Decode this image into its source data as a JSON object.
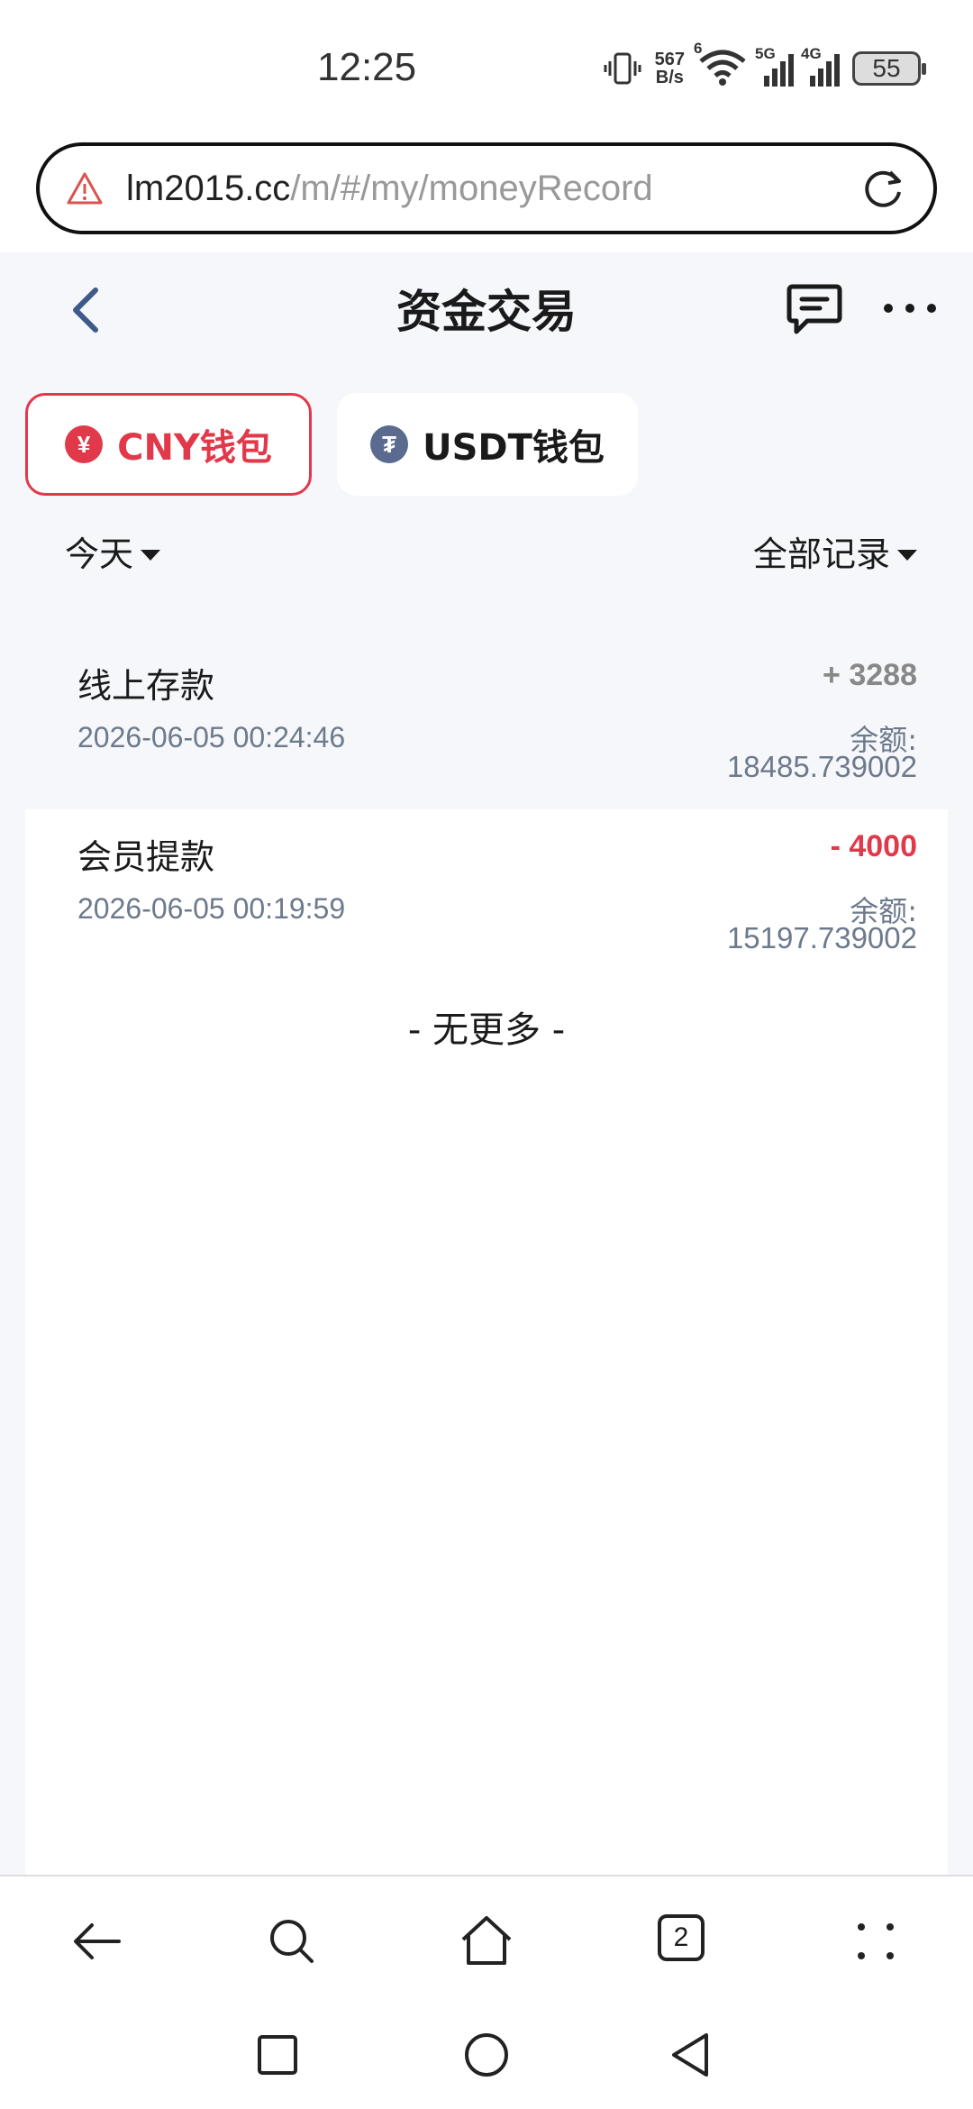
{
  "status_bar": {
    "time": "12:25",
    "net_speed_top": "567",
    "net_speed_bottom": "B/s",
    "wifi_tag": "6",
    "sim1_tag": "5G",
    "sim2_tag": "4G",
    "battery": "55"
  },
  "browser": {
    "url_host": "lm2015.cc",
    "url_path": "/m/#/my/moneyRecord",
    "tab_count": "2"
  },
  "header": {
    "title": "资金交易"
  },
  "wallets": [
    {
      "label": "CNY钱包",
      "coin_symbol": "¥",
      "active": true
    },
    {
      "label": "USDT钱包",
      "coin_symbol": "₮",
      "active": false
    }
  ],
  "filters": {
    "date": "今天",
    "type": "全部记录"
  },
  "records": [
    {
      "title": "线上存款",
      "time": "2026-06-05 00:24:46",
      "amount": "+ 3288",
      "balance_label": "余额:",
      "balance": "18485.739002"
    },
    {
      "title": "会员提款",
      "time": "2026-06-05 00:19:59",
      "amount": "- 4000",
      "balance_label": "余额:",
      "balance": "15197.739002"
    }
  ],
  "footer_text": "- 无更多 -",
  "colors": {
    "accent": "#e2394a",
    "page_bg": "#f5f7fb",
    "muted": "#6d7a8c"
  }
}
